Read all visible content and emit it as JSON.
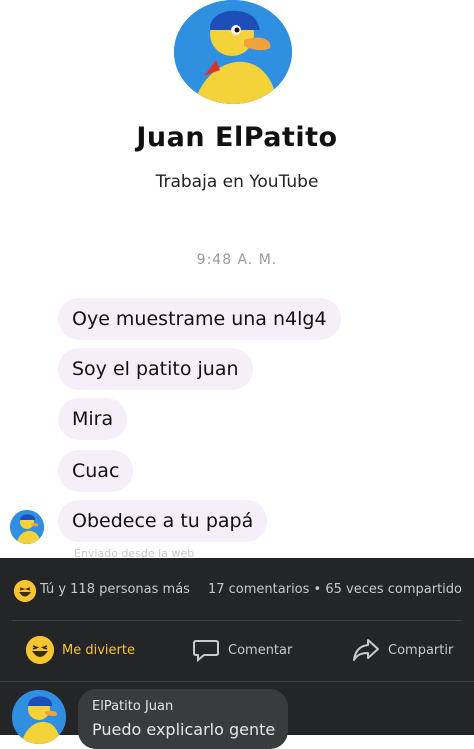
{
  "profile": {
    "name": "Juan ElPatito",
    "work": "Trabaja en YouTube"
  },
  "chat": {
    "timestamp": "9:48 A. M.",
    "messages": [
      "Oye muestrame una n4lg4",
      "Soy el patito juan",
      "Mira",
      "Cuac",
      "Obedece a tu papá"
    ],
    "sent_note": "Enviado desde la web"
  },
  "post": {
    "reactions_text": "Tú y 118 personas más",
    "counts_text": "17 comentarios • 65 veces compartido",
    "actions": {
      "like": "Me divierte",
      "comment": "Comentar",
      "share": "Compartir"
    },
    "comment": {
      "author": "ElPatito Juan",
      "text": "Puedo explicarlo gente"
    }
  },
  "colors": {
    "bubble": "#f6eef8",
    "dark_panel": "#242526",
    "haha_yellow": "#f7c531",
    "avatar_blue": "#2f8fe0"
  },
  "icons": [
    "duck-avatar-icon",
    "haha-reaction-icon",
    "comment-icon",
    "share-icon"
  ]
}
